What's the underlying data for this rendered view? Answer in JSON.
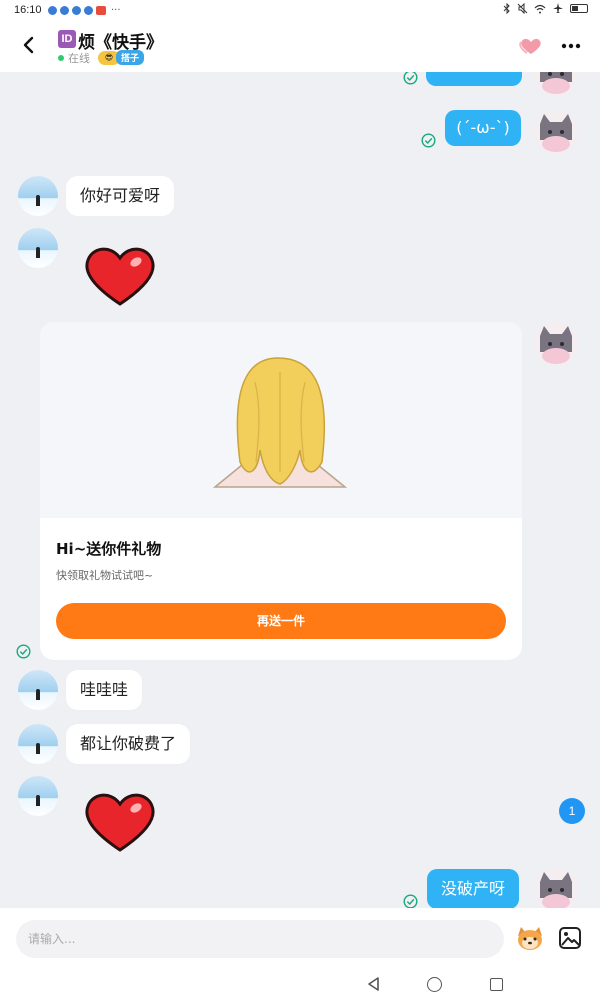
{
  "status_bar": {
    "time": "16:10",
    "more": "···"
  },
  "header": {
    "id_badge": "ID",
    "title": "烦《快手》",
    "online_status": "在线",
    "tag_label": "搭子"
  },
  "messages": {
    "me_partial": "",
    "me_emoticon": "(ˊ-ω-ˋ)",
    "other_1": "你好可爱呀",
    "other_2": "哇哇哇",
    "other_3": "都让你破费了",
    "me_last": "没破产呀"
  },
  "gift_card": {
    "title": "Hi~送你件礼物",
    "subtitle": "快领取礼物试试吧~",
    "button": "再送一件"
  },
  "unread_count": "1",
  "input": {
    "placeholder": "请输入..."
  },
  "colors": {
    "my_bubble": "#2fb3f5",
    "other_bubble": "#ffffff",
    "gift_button": "#ff7a15",
    "background": "#eef0f4",
    "sent_check": "#1aa87a"
  },
  "icons": [
    "back-arrow-icon",
    "heart-icon",
    "more-icon",
    "check-icon",
    "heart-sticker-icon",
    "emoji-icon",
    "image-icon",
    "nav-back-icon",
    "nav-home-icon",
    "nav-recent-icon"
  ]
}
